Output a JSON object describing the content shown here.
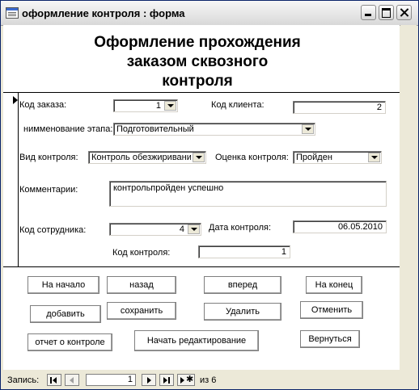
{
  "window": {
    "title": "оформление контроля : форма"
  },
  "form": {
    "heading_line1": "Оформление прохождения",
    "heading_line2": "заказом сквозного",
    "heading_line3": "контроля"
  },
  "fields": {
    "order_code": {
      "label": "Код заказа:",
      "value": "1"
    },
    "client_code": {
      "label": "Код клиента:",
      "value": "2"
    },
    "stage_name": {
      "label": "нимменование этапа:",
      "value": "Подготовительный"
    },
    "control_type": {
      "label": "Вид контроля:",
      "value": "Контроль обезжиривани"
    },
    "control_rating": {
      "label": "Оценка контроля:",
      "value": "Пройден"
    },
    "comments": {
      "label": "Комментарии:",
      "value": "контрольпройден успешно"
    },
    "employee_code": {
      "label": "Код сотрудника:",
      "value": "4"
    },
    "control_date": {
      "label": "Дата контроля:",
      "value": "06.05.2010"
    },
    "control_code": {
      "label": "Код контроля:",
      "value": "1"
    }
  },
  "buttons": {
    "first": "На начало",
    "back": "назад",
    "forward": "вперед",
    "last": "На конец",
    "add": "добавить",
    "save": "сохранить",
    "delete": "Удалить",
    "cancel": "Отменить",
    "report": "отчет о контроле",
    "edit": "Начать редактирование",
    "return": "Вернуться"
  },
  "navigation": {
    "record_label": "Запись:",
    "current_record": "1",
    "of_label": "из",
    "total_records": "6"
  }
}
